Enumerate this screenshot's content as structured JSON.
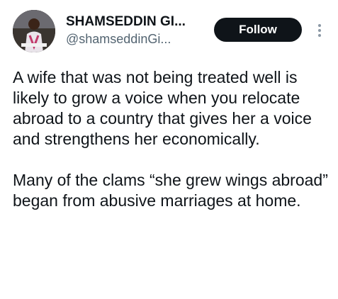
{
  "author": {
    "display_name": "SHAMSEDDIN GI...",
    "handle": "@shamseddinGi...",
    "avatar_icon": "profile-photo"
  },
  "actions": {
    "follow_label": "Follow",
    "more_icon": "more-vertical-icon"
  },
  "tweet": {
    "paragraphs": [
      "A wife that was not being treated well is likely to grow a voice when you relocate abroad to a country that gives her a voice and strengthens her economically.",
      "Many of the clams “she grew wings abroad” began from abusive marriages at home."
    ]
  },
  "colors": {
    "text": "#0f1419",
    "secondary": "#536471",
    "follow_bg": "#0f1419",
    "follow_text": "#ffffff"
  }
}
